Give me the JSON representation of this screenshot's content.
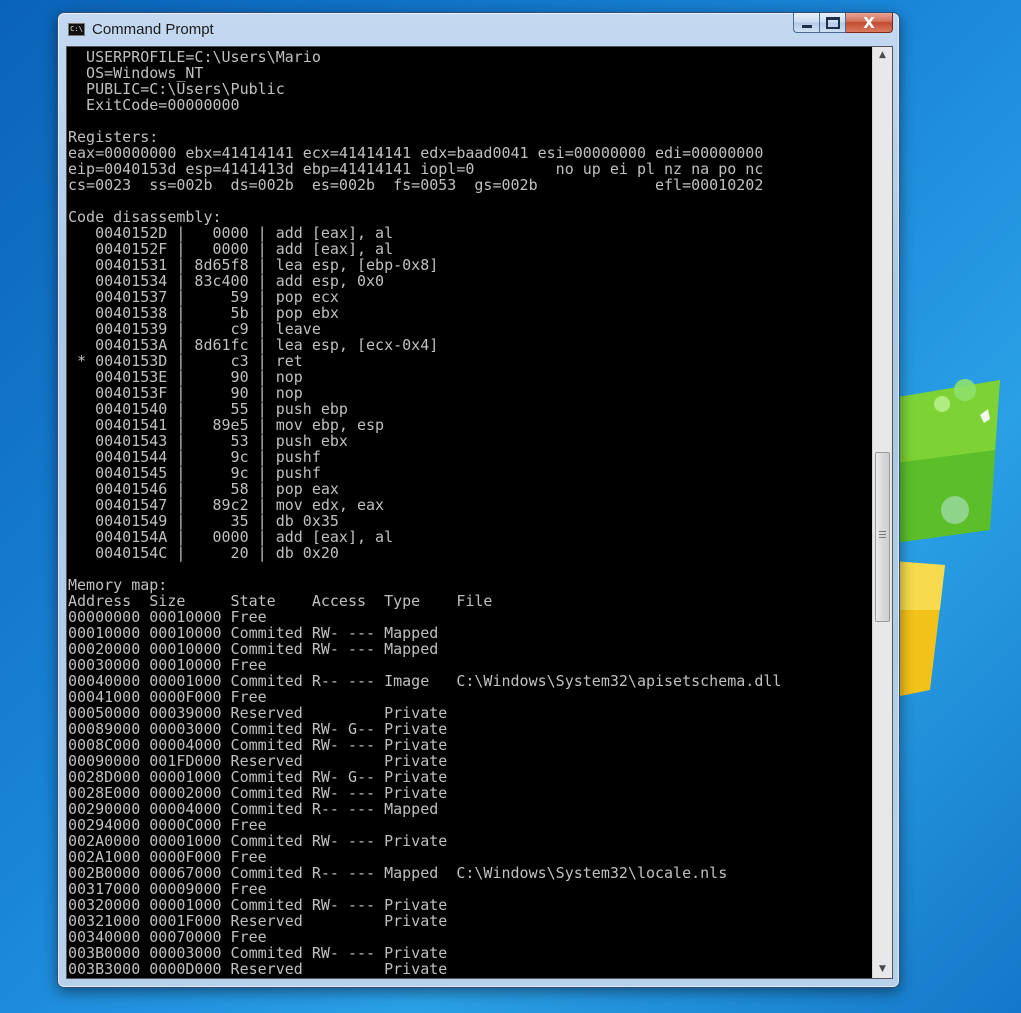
{
  "window": {
    "title": "Command Prompt",
    "icon_label": "C:\\",
    "close_glyph": "X"
  },
  "console_lines": [
    "  USERPROFILE=C:\\Users\\Mario",
    "  OS=Windows_NT",
    "  PUBLIC=C:\\Users\\Public",
    "  ExitCode=00000000",
    "",
    "Registers:",
    "eax=00000000 ebx=41414141 ecx=41414141 edx=baad0041 esi=00000000 edi=00000000",
    "eip=0040153d esp=4141413d ebp=41414141 iopl=0         no up ei pl nz na po nc",
    "cs=0023  ss=002b  ds=002b  es=002b  fs=0053  gs=002b             efl=00010202",
    "",
    "Code disassembly:",
    "   0040152D |   0000 | add [eax], al",
    "   0040152F |   0000 | add [eax], al",
    "   00401531 | 8d65f8 | lea esp, [ebp-0x8]",
    "   00401534 | 83c400 | add esp, 0x0",
    "   00401537 |     59 | pop ecx",
    "   00401538 |     5b | pop ebx",
    "   00401539 |     c9 | leave",
    "   0040153A | 8d61fc | lea esp, [ecx-0x4]",
    " * 0040153D |     c3 | ret",
    "   0040153E |     90 | nop",
    "   0040153F |     90 | nop",
    "   00401540 |     55 | push ebp",
    "   00401541 |   89e5 | mov ebp, esp",
    "   00401543 |     53 | push ebx",
    "   00401544 |     9c | pushf",
    "   00401545 |     9c | pushf",
    "   00401546 |     58 | pop eax",
    "   00401547 |   89c2 | mov edx, eax",
    "   00401549 |     35 | db 0x35",
    "   0040154A |   0000 | add [eax], al",
    "   0040154C |     20 | db 0x20",
    "",
    "Memory map:",
    "Address  Size     State    Access  Type    File",
    "00000000 00010000 Free",
    "00010000 00010000 Commited RW- --- Mapped",
    "00020000 00010000 Commited RW- --- Mapped",
    "00030000 00010000 Free",
    "00040000 00001000 Commited R-- --- Image   C:\\Windows\\System32\\apisetschema.dll",
    "00041000 0000F000 Free",
    "00050000 00039000 Reserved         Private",
    "00089000 00003000 Commited RW- G-- Private",
    "0008C000 00004000 Commited RW- --- Private",
    "00090000 001FD000 Reserved         Private",
    "0028D000 00001000 Commited RW- G-- Private",
    "0028E000 00002000 Commited RW- --- Private",
    "00290000 00004000 Commited R-- --- Mapped",
    "00294000 0000C000 Free",
    "002A0000 00001000 Commited RW- --- Private",
    "002A1000 0000F000 Free",
    "002B0000 00067000 Commited R-- --- Mapped  C:\\Windows\\System32\\locale.nls",
    "00317000 00009000 Free",
    "00320000 00001000 Commited RW- --- Private",
    "00321000 0001F000 Reserved         Private",
    "00340000 00070000 Free",
    "003B0000 00003000 Commited RW- --- Private",
    "003B3000 0000D000 Reserved         Private"
  ],
  "scrollbar": {
    "up_arrow": "▲",
    "down_arrow": "▼",
    "thumb_position": 0.52
  },
  "colors": {
    "console_text": "#c0c0c0",
    "console_bg": "#000000"
  }
}
